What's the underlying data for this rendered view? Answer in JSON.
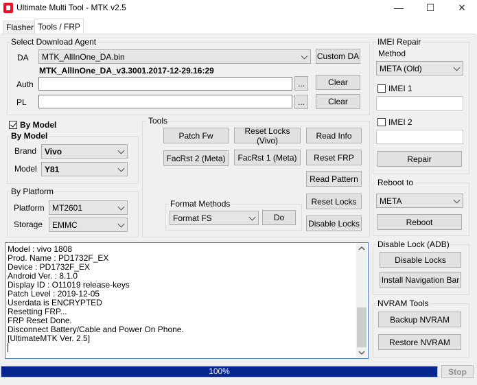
{
  "window": {
    "title": "Ultimate Multi Tool - MTK v2.5",
    "minimize": "—",
    "maximize": "☐",
    "close": "✕"
  },
  "tabs": [
    {
      "label": "Flasher",
      "active": false
    },
    {
      "label": "Tools / FRP",
      "active": true
    }
  ],
  "download_agent": {
    "group_label": "Select Download Agent",
    "da_label": "DA",
    "da_value": "MTK_AllInOne_DA.bin",
    "custom_da_button": "Custom DA",
    "da_version": "MTK_AllInOne_DA_v3.3001.2017-12-29.16:29",
    "auth_label": "Auth",
    "auth_value": "",
    "auth_browse": "...",
    "auth_clear": "Clear",
    "pl_label": "PL",
    "pl_value": "",
    "pl_browse": "...",
    "pl_clear": "Clear"
  },
  "by_model": {
    "checkbox_label": "By Model",
    "checked": true,
    "group_label": "By Model",
    "brand_label": "Brand",
    "brand_value": "Vivo",
    "model_label": "Model",
    "model_value": "Y81"
  },
  "by_platform": {
    "group_label": "By Platform",
    "platform_label": "Platform",
    "platform_value": "MT2601",
    "storage_label": "Storage",
    "storage_value": "EMMC"
  },
  "tools": {
    "group_label": "Tools",
    "patch_fw": "Patch Fw",
    "reset_locks_vivo": "Reset Locks (Vivo)",
    "read_info": "Read Info",
    "facrst2_meta": "FacRst 2 (Meta)",
    "facrst1_meta": "FacRst 1 (Meta)",
    "reset_frp": "Reset FRP",
    "read_pattern": "Read Pattern",
    "reset_locks": "Reset Locks",
    "disable_locks": "Disable Locks",
    "format_methods_label": "Format Methods",
    "format_value": "Format FS",
    "do_button": "Do"
  },
  "imei_repair": {
    "group_label": "IMEI Repair",
    "method_label": "Method",
    "method_value": "META (Old)",
    "imei1_label": "IMEI 1",
    "imei1_checked": false,
    "imei1_value": "",
    "imei2_label": "IMEI 2",
    "imei2_checked": false,
    "imei2_value": "",
    "repair_button": "Repair"
  },
  "reboot": {
    "group_label": "Reboot to",
    "mode_value": "META",
    "reboot_button": "Reboot"
  },
  "disable_lock_adb": {
    "group_label": "Disable Lock (ADB)",
    "disable_locks_button": "Disable Locks",
    "install_nav_bar_button": "Install Navigation Bar"
  },
  "nvram": {
    "group_label": "NVRAM Tools",
    "backup_button": "Backup NVRAM",
    "restore_button": "Restore NVRAM"
  },
  "log": [
    "Model : vivo 1808",
    "Prod. Name : PD1732F_EX",
    "Device : PD1732F_EX",
    "Android Ver. : 8.1.0",
    "Display ID : O11019 release-keys",
    "Patch Level : 2019-12-05",
    "Userdata is ENCRYPTED",
    "Resetting FRP...",
    "FRP Reset Done.",
    "Disconnect Battery/Cable and Power On Phone.",
    "[UltimateMTK Ver. 2.5]"
  ],
  "progress": {
    "value": 1.0,
    "text": "100%",
    "stop_button": "Stop"
  },
  "colors": {
    "progress_fill": "#06258f",
    "log_border": "#4b7cc4",
    "close_icon_bg": "#e81123"
  }
}
